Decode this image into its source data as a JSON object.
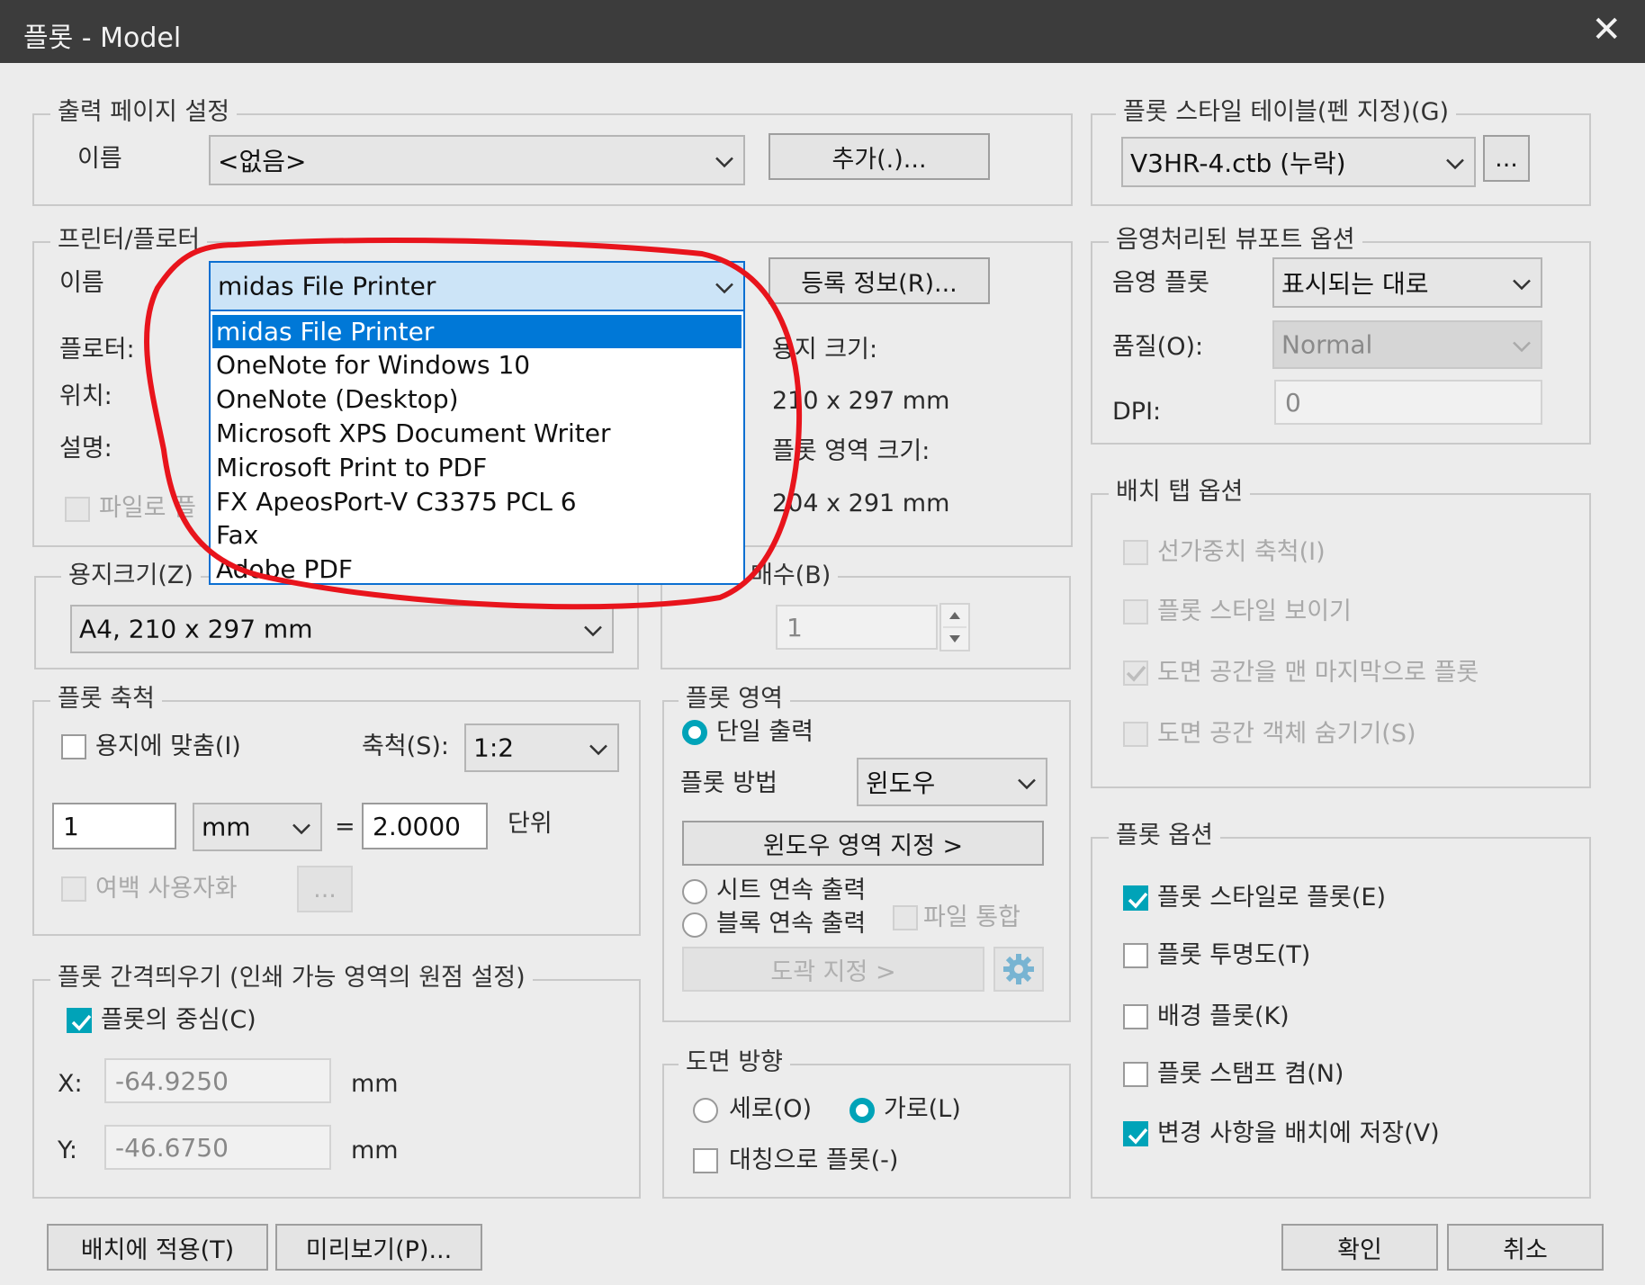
{
  "window": {
    "title": "플롯 - Model",
    "close": "✕"
  },
  "page_setup": {
    "legend": "출력 페이지 설정",
    "name_label": "이름",
    "name_value": "<없음>",
    "add_button": "추가(.)..."
  },
  "printer": {
    "legend": "프린터/플로터",
    "name_label": "이름",
    "selected": "midas File Printer",
    "properties_button": "등록 정보(R)...",
    "plotter_label": "플로터:",
    "location_label": "위치:",
    "description_label": "설명:",
    "plot_to_file": "파일로 플",
    "paper_size_label": "용지 크기:",
    "paper_size_value": "210 x 297 mm",
    "plot_area_label": "플롯 영역 크기:",
    "plot_area_value": "204 x 291 mm",
    "options": [
      "midas File Printer",
      "OneNote for Windows 10",
      "OneNote (Desktop)",
      "Microsoft XPS Document Writer",
      "Microsoft Print to PDF",
      "FX ApeosPort-V C3375 PCL 6",
      "Fax",
      "Adobe PDF"
    ]
  },
  "paper": {
    "legend": "용지크기(Z)",
    "value": "A4, 210 x 297 mm"
  },
  "copies": {
    "legend": "매수(B)",
    "value": "1"
  },
  "scale": {
    "legend": "플롯 축척",
    "fit": "용지에 맞춤(I)",
    "scale_label": "축척(S):",
    "scale_value": "1:2",
    "left_value": "1",
    "unit_value": "mm",
    "equals": "=",
    "right_value": "2.0000",
    "unit_label": "단위",
    "lineweights": "여백 사용자화",
    "dots": "..."
  },
  "offset": {
    "legend": "플롯 간격띄우기 (인쇄 가능 영역의 원점 설정)",
    "center": "플롯의 중심(C)",
    "x_label": "X:",
    "x_value": "-64.9250",
    "x_unit": "mm",
    "y_label": "Y:",
    "y_value": "-46.6750",
    "y_unit": "mm"
  },
  "area": {
    "legend": "플롯 영역",
    "single": "단일 출력",
    "method_label": "플롯 방법",
    "method_value": "윈도우",
    "window_button": "윈도우 영역 지정 >",
    "sheet_batch": "시트 연속 출력",
    "block_batch": "블록 연속 출력",
    "merge_file": "파일 통합",
    "frame_button": "도곽 지정 >"
  },
  "orientation": {
    "legend": "도면 방향",
    "portrait": "세로(O)",
    "landscape": "가로(L)",
    "upside": "대칭으로 플롯(-)"
  },
  "style_table": {
    "legend": "플롯 스타일 테이블(펜 지정)(G)",
    "value": "V3HR-4.ctb (누락)",
    "dots": "..."
  },
  "shaded": {
    "legend": "음영처리된 뷰포트 옵션",
    "shade_label": "음영 플롯",
    "shade_value": "표시되는 대로",
    "quality_label": "품질(O):",
    "quality_value": "Normal",
    "dpi_label": "DPI:",
    "dpi_value": "0"
  },
  "layout_tab": {
    "legend": "배치 탭 옵션",
    "items": [
      "선가중치 축척(I)",
      "플롯 스타일 보이기",
      "도면 공간을 맨 마지막으로 플롯",
      "도면 공간 객체 숨기기(S)"
    ]
  },
  "plot_options": {
    "legend": "플롯 옵션",
    "items": [
      "플롯 스타일로 플롯(E)",
      "플롯 투명도(T)",
      "배경 플롯(K)",
      "플롯 스탬프 켬(N)",
      "변경 사항을 배치에 저장(V)"
    ]
  },
  "footer": {
    "apply": "배치에 적용(T)",
    "preview": "미리보기(P)...",
    "ok": "확인",
    "cancel": "취소"
  },
  "colors": {
    "accent": "#00a3b8",
    "selection": "#0078d7",
    "annotation": "#e8141c"
  }
}
